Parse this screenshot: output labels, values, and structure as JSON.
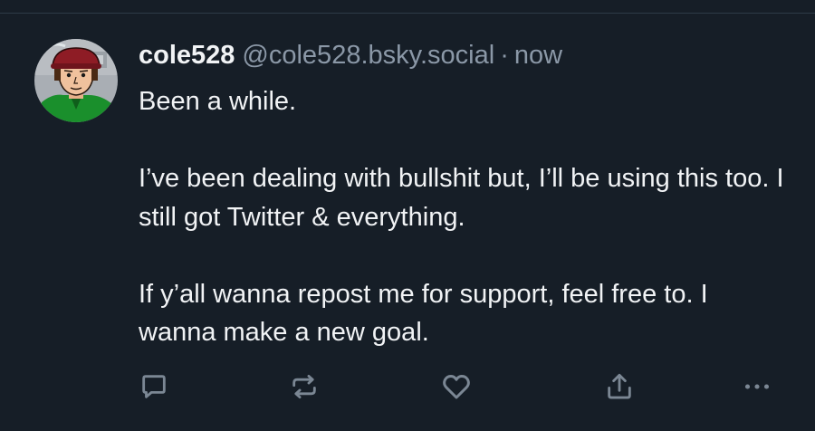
{
  "post": {
    "author": {
      "display_name": "cole528",
      "handle": "@cole528.bsky.social"
    },
    "separator": "·",
    "timestamp": "now",
    "paragraphs": [
      "Been a while.",
      "I’ve been dealing with bullshit but, I’ll be using this too. I still got Twitter & everything.",
      "If y’all wanna repost me for support, feel free to. I wanna make a new goal."
    ]
  },
  "actions": [
    {
      "name": "reply",
      "icon": "speech-bubble-icon"
    },
    {
      "name": "repost",
      "icon": "repost-arrows-icon"
    },
    {
      "name": "like",
      "icon": "heart-icon"
    },
    {
      "name": "share",
      "icon": "share-upload-icon"
    },
    {
      "name": "more",
      "icon": "ellipsis-icon"
    }
  ],
  "colors": {
    "background": "#161e27",
    "text_primary": "#f1f3f5",
    "text_secondary": "#8b98a7",
    "icon": "#7b8794",
    "avatar_jacket": "#1a8f2c",
    "avatar_cap": "#8e1c25"
  }
}
